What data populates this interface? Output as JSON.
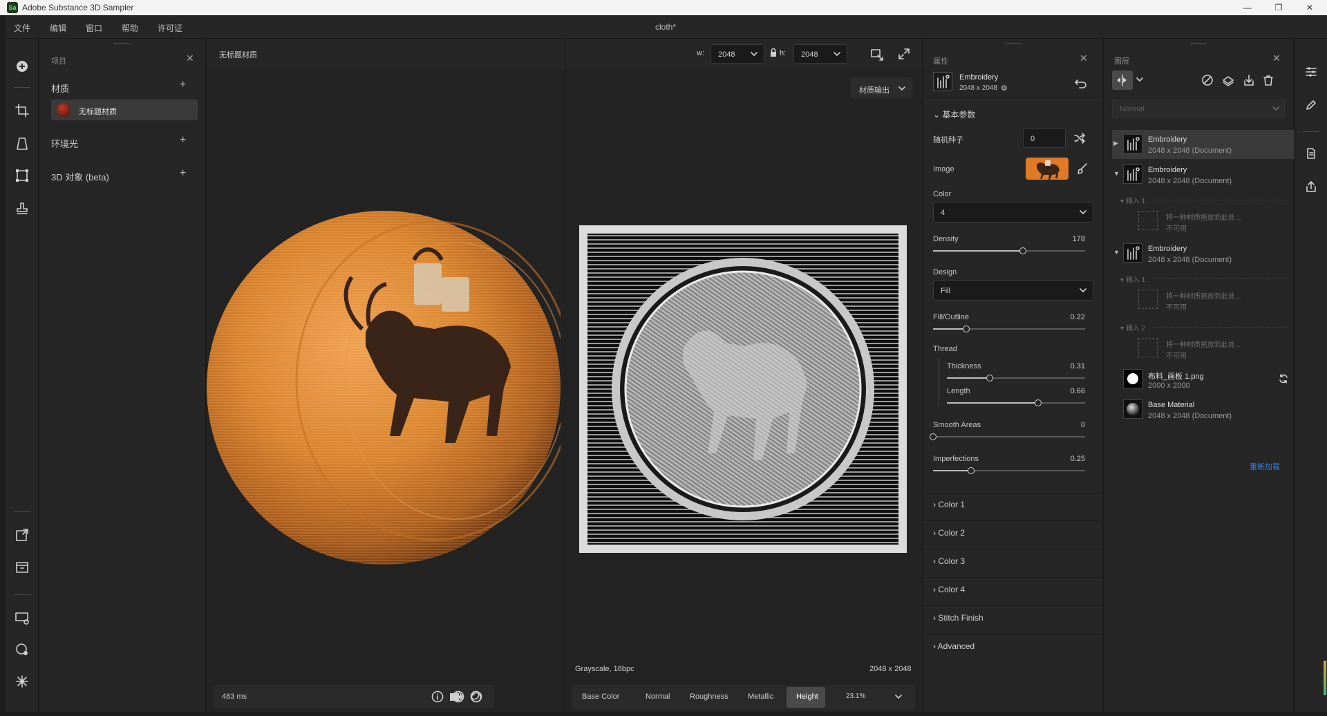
{
  "window": {
    "app_title": "Adobe Substance 3D Sampler",
    "logo": "Sa"
  },
  "menu": {
    "items": [
      "文件",
      "编辑",
      "窗口",
      "帮助",
      "许可证"
    ],
    "doc_title": "cloth*"
  },
  "project": {
    "title": "项目",
    "materials_label": "材质",
    "material_item": "无标题材质",
    "env_label": "环境光",
    "objects_label": "3D 对象 (beta)"
  },
  "viewport3d": {
    "title": "无标题材质",
    "fps": "483 ms"
  },
  "viewport2d": {
    "w_label": "w:",
    "w_value": "2048",
    "h_label": "h:",
    "h_value": "2048",
    "output_label": "材质输出",
    "format": "Grayscale, 16bpc",
    "resolution": "2048 x 2048",
    "channels": [
      "Base Color",
      "Normal",
      "Roughness",
      "Metallic",
      "Height"
    ],
    "active_channel": "Height",
    "zoom": "23.1%"
  },
  "properties": {
    "title": "属性",
    "filter_name": "Embroidery",
    "filter_size": "2048 x 2048",
    "basic_params": "基本参数",
    "seed_label": "随机种子",
    "seed_value": "0",
    "image_label": "Image",
    "color_label": "Color",
    "color_value": "4",
    "density_label": "Density",
    "density_value": "178",
    "density_pos": 0.59,
    "design_label": "Design",
    "design_value": "Fill",
    "filloutline_label": "Fill/Outline",
    "filloutline_value": "0.22",
    "filloutline_pos": 0.22,
    "thread_label": "Thread",
    "thickness_label": "Thickness",
    "thickness_value": "0.31",
    "thickness_pos": 0.31,
    "length_label": "Length",
    "length_value": "0.66",
    "length_pos": 0.66,
    "smooth_label": "Smooth Areas",
    "smooth_value": "0",
    "smooth_pos": 0,
    "imperf_label": "Imperfections",
    "imperf_value": "0.25",
    "imperf_pos": 0.25,
    "groups": [
      "Color 1",
      "Color 2",
      "Color 3",
      "Color 4",
      "Stitch Finish",
      "Advanced"
    ]
  },
  "layers": {
    "title": "图层",
    "blend_mode": "Normal",
    "items": [
      {
        "name": "Embroidery",
        "sub": "2048 x 2048 (Document)"
      },
      {
        "name": "Embroidery",
        "sub": "2048 x 2048 (Document)"
      },
      {
        "name": "Embroidery",
        "sub": "2048 x 2048 (Document)"
      },
      {
        "name": "布料_画板 1.png",
        "sub": "2000 x 2000"
      },
      {
        "name": "Base Material",
        "sub": "2048 x 2048 (Document)"
      }
    ],
    "input1": "输入 1",
    "input2": "输入 2",
    "drop_hint": "将一种材质拖放到此处...",
    "unavailable": "不可用",
    "reload": "重新加载"
  },
  "colors": {
    "accent": "#2680eb",
    "orange": "#d9822b",
    "panel": "#262626"
  }
}
